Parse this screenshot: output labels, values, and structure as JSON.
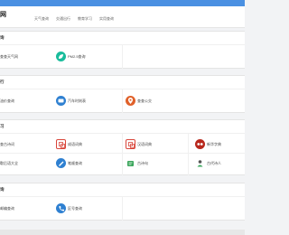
{
  "header": {
    "logo": "网",
    "nav": [
      "天气查询",
      "交通出行",
      "教育学习",
      "实用查询"
    ]
  },
  "sections": [
    {
      "title": "询",
      "items": [
        "查查天气网",
        "PM2.5查询"
      ]
    },
    {
      "title": "行",
      "items": [
        "油价查询",
        "汽车时刻表",
        "查查公交"
      ]
    },
    {
      "title": "习",
      "items": [
        "查古诗词",
        "成语词典",
        "汉语词典",
        "新华字典",
        "歇后语大全",
        "笔顺查询",
        "古诗句",
        "古代诗人"
      ]
    },
    {
      "title": "询",
      "items": [
        "邮编查询",
        "区号查询"
      ]
    }
  ],
  "colors": {
    "topbar": "#4a90e2",
    "teal": "#1abc9c",
    "blue": "#2f80d1",
    "orange": "#e0612a",
    "red": "#d9463b",
    "dark_red": "#b8281d",
    "green": "#3aa55b"
  }
}
